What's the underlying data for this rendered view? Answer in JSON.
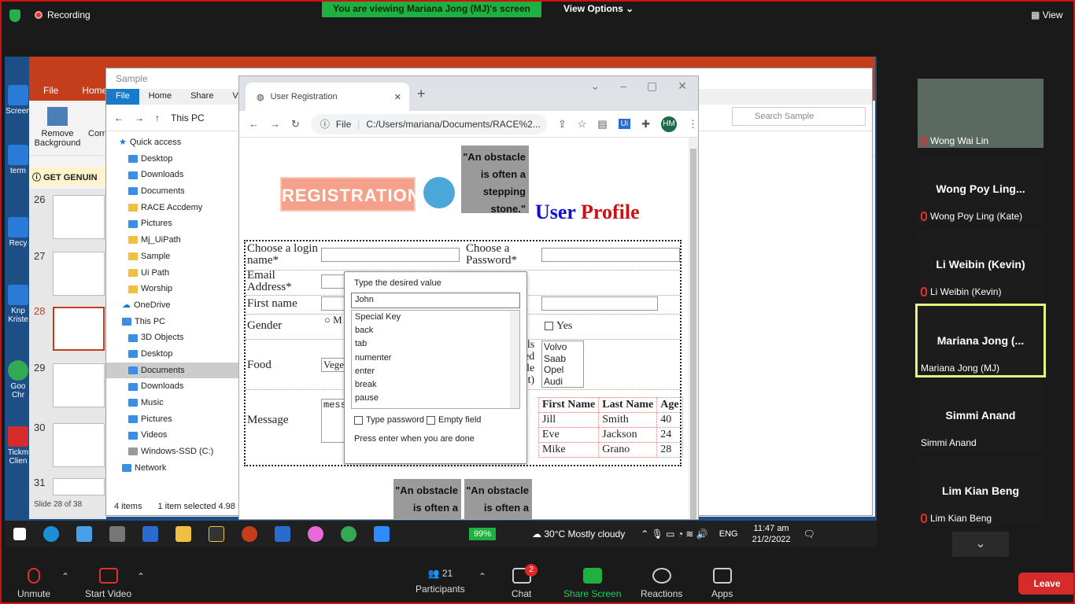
{
  "zoom": {
    "recording": "Recording",
    "viewing_banner": "You are viewing Mariana Jong (MJ)'s screen",
    "view_options": "View Options",
    "view": "View"
  },
  "desktop_icons": [
    "Screen",
    "term",
    "Recy",
    "Knp Kriste",
    "Goo Chr",
    "Tickm Clien"
  ],
  "powerpoint": {
    "menu": [
      "File",
      "Home"
    ],
    "remove_background": "Remove Background",
    "corr": "Corre",
    "info_banner": "GET GENUIN",
    "slide_numbers": [
      "26",
      "27",
      "28",
      "29",
      "30",
      "31"
    ],
    "status": "Slide 28 of 38"
  },
  "explorer": {
    "title": "Sample",
    "tabs": [
      "File",
      "Home",
      "Share",
      "View"
    ],
    "path": "This PC",
    "search_placeholder": "Search Sample",
    "nav": [
      "Quick access",
      "Desktop",
      "Downloads",
      "Documents",
      "RACE Accdemy",
      "Pictures",
      "Mj_UiPath",
      "Sample",
      "Ui Path",
      "Worship",
      "OneDrive",
      "This PC",
      "3D Objects",
      "Desktop",
      "Documents",
      "Downloads",
      "Music",
      "Pictures",
      "Videos",
      "Windows-SSD (C:)",
      "Network"
    ],
    "status_items": "4 items",
    "status_selected": "1 item selected  4.98 K"
  },
  "chrome": {
    "tab_title": "User Registration",
    "url": "C:/Users/mariana/Documents/RACE%2...",
    "file_label": "File",
    "profile": "HM"
  },
  "page": {
    "registration": "REGISTRATION",
    "quote": "\"An obstacle is often a stepping stone.\"",
    "user": "User",
    "profile": "Profile",
    "labels": {
      "login": "Choose a login name*",
      "password": "Choose a Password*",
      "email": "Email Address*",
      "first_name": "First name",
      "gender": "Gender",
      "food": "Food",
      "message": "Message"
    },
    "gender_option": "M",
    "yes": "Yes",
    "food_value": "Vege",
    "message_value": "mess",
    "partial_text": [
      "ls",
      "ed",
      "le",
      "t)"
    ],
    "cars": [
      "Volvo",
      "Saab",
      "Opel",
      "Audi"
    ],
    "table_headers": [
      "First Name",
      "Last Name",
      "Age"
    ],
    "table_rows": [
      [
        "Jill",
        "Smith",
        "40"
      ],
      [
        "Eve",
        "Jackson",
        "24"
      ],
      [
        "Mike",
        "Grano",
        "28"
      ]
    ]
  },
  "popup": {
    "title": "Type the desired value",
    "value": "John",
    "list": [
      "Special Key",
      "back",
      "tab",
      "numenter",
      "enter",
      "break",
      "pause"
    ],
    "type_password": "Type password",
    "empty_field": "Empty field",
    "hint": "Press enter when you are done"
  },
  "taskbar": {
    "battery": "99%",
    "weather": "30°C  Mostly cloudy",
    "lang": "ENG",
    "time": "11:47 am",
    "date": "21/2/2022"
  },
  "participants": [
    {
      "name": "",
      "label": "Wong Wai Lin",
      "muted": true
    },
    {
      "name": "Wong Poy Ling...",
      "label": "Wong Poy Ling (Kate)",
      "muted": true
    },
    {
      "name": "Li Weibin (Kevin)",
      "label": "Li Weibin (Kevin)",
      "muted": true
    },
    {
      "name": "Mariana Jong (...",
      "label": "Mariana Jong (MJ)",
      "muted": false
    },
    {
      "name": "Simmi Anand",
      "label": "Simmi Anand",
      "muted": false
    },
    {
      "name": "Lim Kian Beng",
      "label": "Lim Kian Beng",
      "muted": true
    }
  ],
  "bottom": {
    "unmute": "Unmute",
    "start_video": "Start Video",
    "participants": "Participants",
    "participants_count": "21",
    "chat": "Chat",
    "chat_badge": "2",
    "share": "Share Screen",
    "reactions": "Reactions",
    "apps": "Apps",
    "leave": "Leave"
  },
  "colors": {
    "zoom_green": "#1fb13f",
    "ppt_red": "#c43e1c",
    "leave_red": "#d62b2b",
    "active_speaker": "#e8f57a"
  }
}
